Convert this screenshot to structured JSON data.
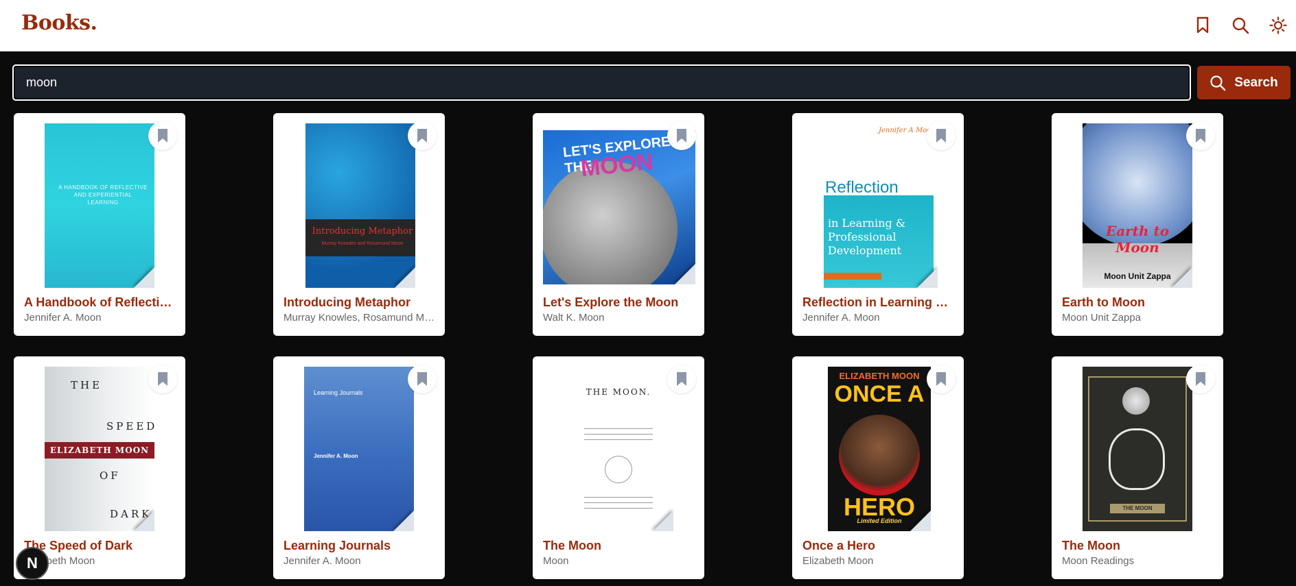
{
  "app": {
    "logo": "Books."
  },
  "search": {
    "value": "moon",
    "button_label": "Search"
  },
  "header_icons": [
    "bookmark-icon",
    "search-icon",
    "sun-icon"
  ],
  "colors": {
    "accent": "#9a2a0c",
    "background": "#0b0b0b",
    "author": "#666666"
  },
  "books": [
    {
      "title": "A Handbook of Reflective and Experiential Learning",
      "author": "Jennifer A. Moon",
      "cover_text": "A HANDBOOK OF REFLECTIVE AND EXPERIENTIAL LEARNING"
    },
    {
      "title": "Introducing Metaphor",
      "author": "Murray Knowles, Rosamund Moon",
      "cover_text": "Introducing Metaphor",
      "cover_sub": "Murray Knowles and Rosamund Moon"
    },
    {
      "title": "Let's Explore the Moon",
      "author": "Walt K. Moon",
      "cover_text": "LET'S EXPLORE THE",
      "cover_sub": "MOON"
    },
    {
      "title": "Reflection in Learning and Professional Development",
      "author": "Jennifer A. Moon",
      "cover_author": "Jennifer A Moon",
      "cover_text": "Reflection",
      "cover_sub": "in Learning & Professional Development"
    },
    {
      "title": "Earth to Moon",
      "author": "Moon Unit Zappa",
      "cover_text": "Earth to Moon",
      "cover_sub": "Moon Unit Zappa"
    },
    {
      "title": "The Speed of Dark",
      "author": "Elizabeth Moon",
      "cover_words": [
        "THE",
        "SPEED",
        "OF",
        "DARK"
      ],
      "cover_band": "ELIZABETH MOON"
    },
    {
      "title": "Learning Journals",
      "author": "Jennifer A. Moon",
      "cover_text": "Learning Journals",
      "cover_sub": "Jennifer A. Moon"
    },
    {
      "title": "The Moon",
      "author": "Moon",
      "cover_text": "THE MOON."
    },
    {
      "title": "Once a Hero",
      "author": "Elizabeth Moon",
      "cover_author": "ELIZABETH MOON",
      "cover_text": "ONCE A",
      "cover_sub": "HERO",
      "cover_edition": "Limited Edition"
    },
    {
      "title": "The Moon",
      "author": "Moon Readings",
      "cover_text": "THE MOON"
    }
  ],
  "badge": {
    "label": "N"
  }
}
